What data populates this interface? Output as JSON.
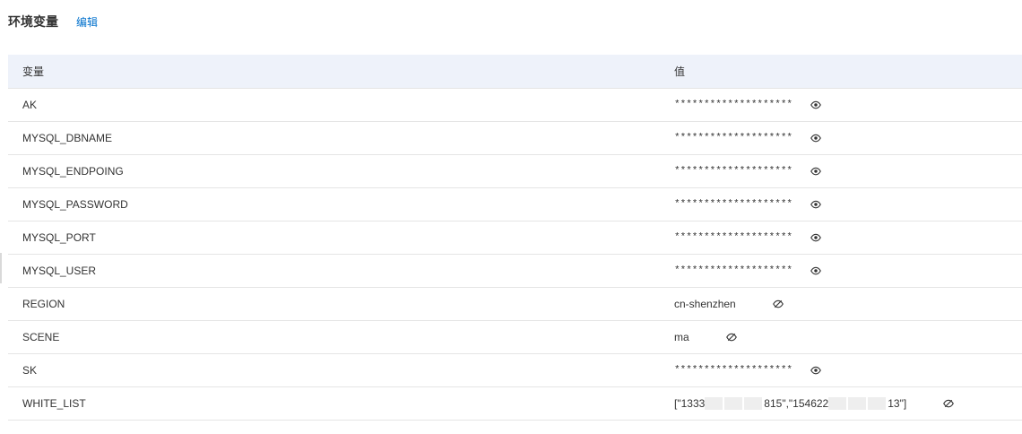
{
  "section": {
    "title": "环境变量",
    "edit_label": "编辑"
  },
  "table": {
    "columns": [
      "变量",
      "值"
    ],
    "rows": [
      {
        "name": "AK",
        "value": "********************",
        "masked": true,
        "icon": "eye-icon"
      },
      {
        "name": "MYSQL_DBNAME",
        "value": "********************",
        "masked": true,
        "icon": "eye-icon"
      },
      {
        "name": "MYSQL_ENDPOING",
        "value": "********************",
        "masked": true,
        "icon": "eye-icon"
      },
      {
        "name": "MYSQL_PASSWORD",
        "value": "********************",
        "masked": true,
        "icon": "eye-icon"
      },
      {
        "name": "MYSQL_PORT",
        "value": "********************",
        "masked": true,
        "icon": "eye-icon"
      },
      {
        "name": "MYSQL_USER",
        "value": "********************",
        "masked": true,
        "icon": "eye-icon"
      },
      {
        "name": "REGION",
        "value": "cn-shenzhen",
        "masked": false,
        "icon": "eye-off-icon"
      },
      {
        "name": "SCENE",
        "value": "ma",
        "masked": false,
        "icon": "eye-off-icon"
      },
      {
        "name": "SK",
        "value": "********************",
        "masked": true,
        "icon": "eye-icon"
      },
      {
        "name": "WHITE_LIST",
        "value_parts": [
          "[\"1333",
          "815\",\"154622",
          "13\"]"
        ],
        "masked": false,
        "icon": "eye-off-icon"
      }
    ]
  }
}
